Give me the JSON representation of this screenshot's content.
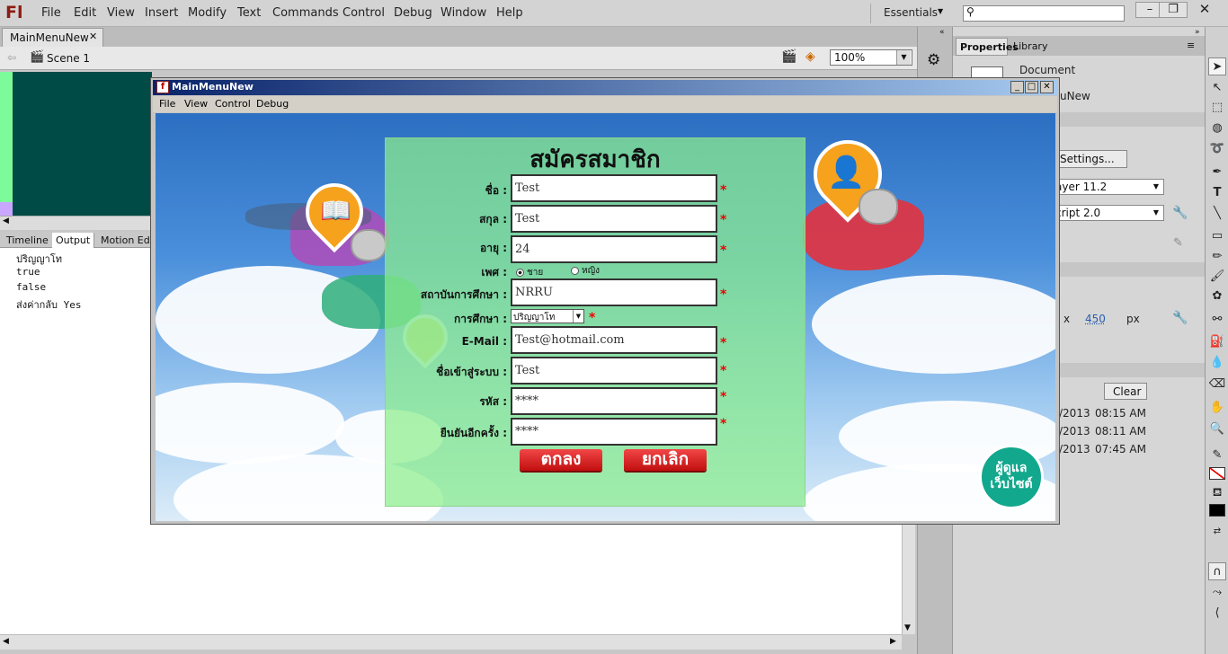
{
  "app": {
    "logo": "Fl",
    "menu": [
      "File",
      "Edit",
      "View",
      "Insert",
      "Modify",
      "Text",
      "Commands",
      "Control",
      "Debug",
      "Window",
      "Help"
    ],
    "workspace": "Essentials"
  },
  "document": {
    "tab": "MainMenuNew",
    "scene": "Scene 1",
    "zoom": "100%"
  },
  "panels": {
    "tabs": [
      "Timeline",
      "Output",
      "Motion Edit"
    ]
  },
  "output": {
    "lines": [
      "ปริญญาโท",
      "true",
      "false",
      "ส่งค่ากลับ Yes"
    ]
  },
  "properties": {
    "tabs": [
      "Properties",
      "Library"
    ],
    "doc_label": "Document",
    "doc_name": "uNew",
    "settings": "Settings...",
    "player": "ayer 11.2",
    "script": "cript 2.0",
    "size_sep": "x",
    "height": "450",
    "unit": "px",
    "clear": "Clear",
    "history": [
      {
        "date": "/2013",
        "time": "08:15 AM"
      },
      {
        "date": "/2013",
        "time": "08:11 AM"
      },
      {
        "date": "/2013",
        "time": "07:45 AM"
      }
    ]
  },
  "player": {
    "title": "MainMenuNew",
    "menu": [
      "File",
      "View",
      "Control",
      "Debug"
    ]
  },
  "form": {
    "title": "สมัครสมาชิก",
    "labels": {
      "first": "ชื่อ :",
      "last": "สกุล :",
      "age": "อายุ :",
      "gender": "เพศ :",
      "school": "สถาบันการศึกษา :",
      "edu": "การศึกษา :",
      "email": "E-Mail :",
      "user": "ชื่อเข้าสู่ระบบ :",
      "pass": "รหัส :",
      "confirm": "ยืนยันอีกครั้ง :"
    },
    "values": {
      "first": "Test",
      "last": "Test",
      "age": "24",
      "school": "NRRU",
      "edu": "ปริญญาโท",
      "email": "Test@hotmail.com",
      "user": "Test",
      "pass": "****",
      "confirm": "****"
    },
    "gender": {
      "male": "ชาย",
      "female": "หญิง"
    },
    "ok": "ตกลง",
    "cancel": "ยกเลิก",
    "logo": [
      "ผู้ดูแล",
      "เว็บไซต์"
    ]
  }
}
